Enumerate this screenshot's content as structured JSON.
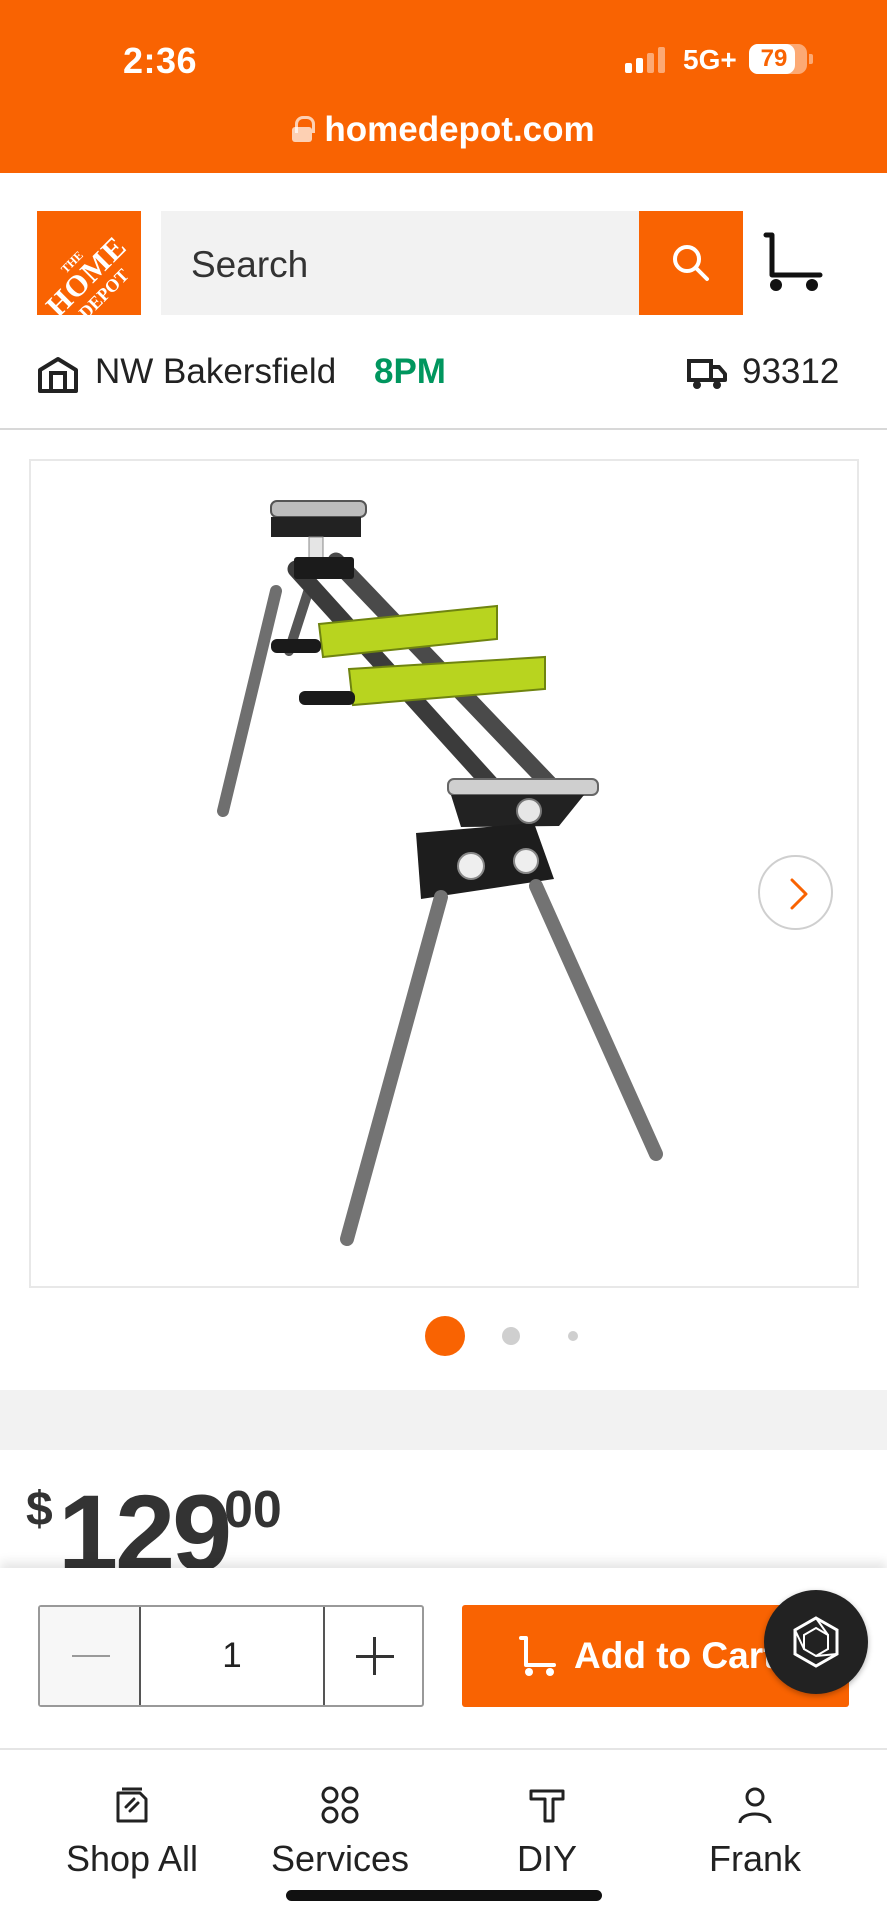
{
  "status_bar": {
    "time": "2:36",
    "network": "5G+",
    "battery_level": 79
  },
  "browser": {
    "url": "homedepot.com"
  },
  "header": {
    "logo_text": [
      "THE",
      "HOME",
      "DEPOT"
    ],
    "search_placeholder": "Search",
    "brand_color": "#f96302"
  },
  "store": {
    "name": "NW Bakersfield",
    "closing_time": "8PM",
    "closing_color": "#00965e",
    "zip": "93312"
  },
  "gallery": {
    "image_alt": "miter saw stand",
    "active_index": 0,
    "dot_count": 3
  },
  "price": {
    "currency": "$",
    "whole": "129",
    "cents": "00"
  },
  "purchase": {
    "quantity": "1",
    "add_to_cart_label": "Add to Cart"
  },
  "bottom_nav": {
    "items": [
      {
        "label": "Shop All",
        "icon": "shop-all-icon"
      },
      {
        "label": "Services",
        "icon": "services-icon"
      },
      {
        "label": "DIY",
        "icon": "diy-icon"
      },
      {
        "label": "Frank",
        "icon": "account-icon"
      }
    ]
  }
}
